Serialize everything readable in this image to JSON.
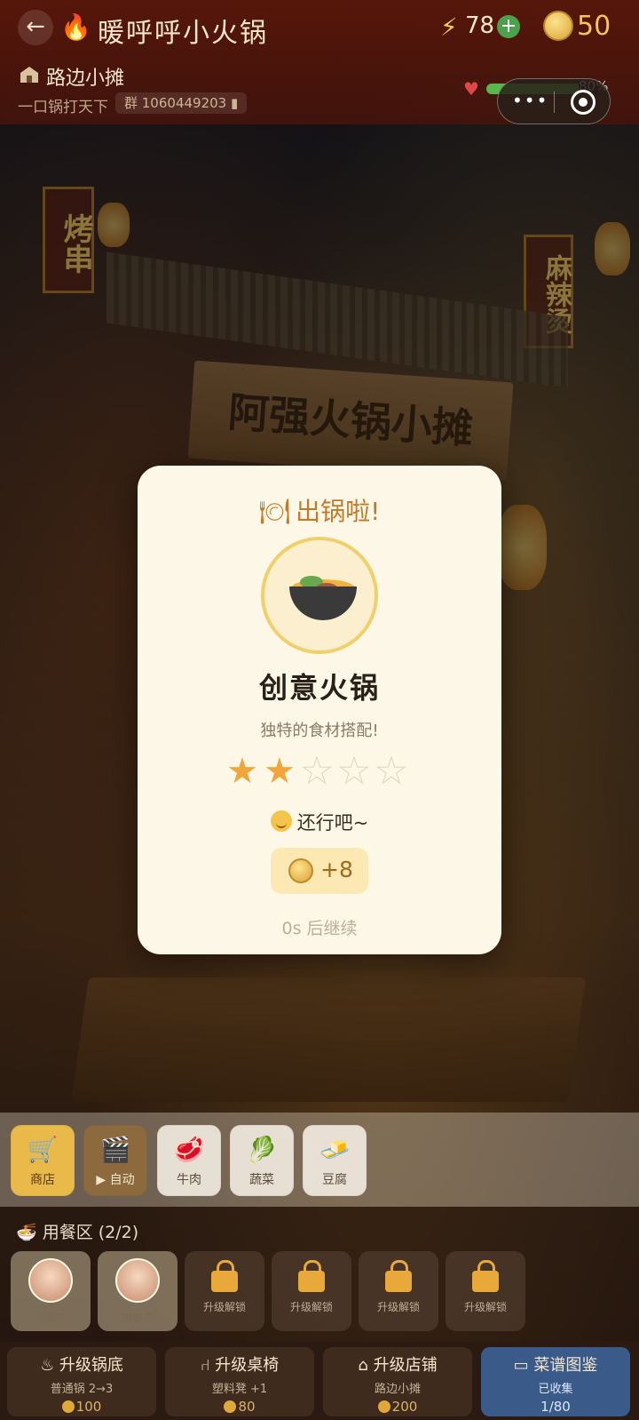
{
  "header": {
    "title": "暖呼呼小火锅",
    "energy": "78",
    "coins": "50",
    "shop_name": "路边小摊",
    "slogan": "一口锅打天下",
    "group": "群 1060449203",
    "hp": "80%",
    "hp_fraction": 0.8
  },
  "scene": {
    "banner": "阿强火锅小摊",
    "sign_left": "烤串",
    "sign_right": "麻辣烫"
  },
  "modal": {
    "heading": "出锅啦!",
    "dish_name": "创意火锅",
    "dish_desc": "独特的食材搭配!",
    "stars_filled": 2,
    "stars_total": 5,
    "verdict": "还行吧~",
    "reward": "+8",
    "countdown": "0s 后继续"
  },
  "toolbar": {
    "items": [
      {
        "label": "商店",
        "icon": "cart-icon"
      },
      {
        "label": "自动",
        "icon": "clapperboard-icon"
      },
      {
        "label": "牛肉",
        "icon": "beef-icon"
      },
      {
        "label": "蔬菜",
        "icon": "vegetables-icon"
      },
      {
        "label": "豆腐",
        "icon": "tofu-icon"
      }
    ]
  },
  "dining": {
    "title": "用餐区 (2/2)",
    "slots": [
      {
        "label": "用餐中"
      },
      {
        "label": "用餐中"
      },
      {
        "label": "升级解锁"
      },
      {
        "label": "升级解锁"
      },
      {
        "label": "升级解锁"
      },
      {
        "label": "升级解锁"
      }
    ]
  },
  "upgrades": [
    {
      "title": "升级锅底",
      "sub": "普通锅 2→3",
      "cost": "100"
    },
    {
      "title": "升级桌椅",
      "sub": "塑料凳 +1",
      "cost": "80"
    },
    {
      "title": "升级店铺",
      "sub": "路边小摊",
      "cost": "200"
    },
    {
      "title": "菜谱图鉴",
      "sub": "已收集",
      "cost": "1/80"
    }
  ],
  "colors": {
    "header_bg": "#5a160a",
    "modal_bg": "#fdf7e8",
    "star_on": "#f0a63a",
    "accent_gold": "#e9b94a",
    "recipe_blue": "#3a5a8a"
  }
}
